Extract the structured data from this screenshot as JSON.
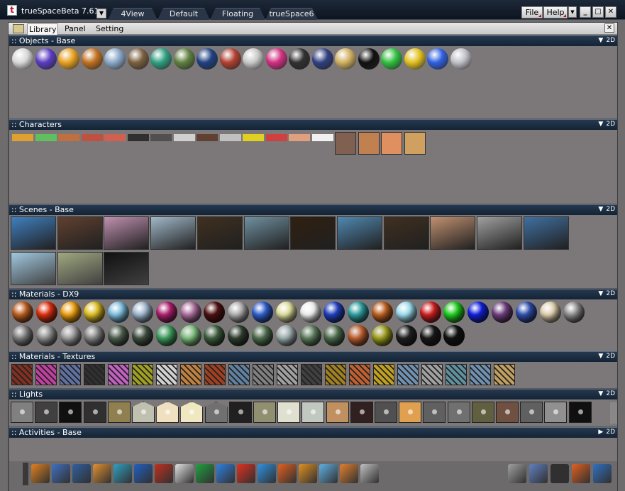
{
  "window": {
    "title": "trueSpaceBeta 7.61",
    "logo_text": "t"
  },
  "views": [
    "4View",
    "Default",
    "Floating",
    "trueSpace6"
  ],
  "menu": {
    "file": "File",
    "help": "Help"
  },
  "window_controls": {
    "minimize": "_",
    "maximize": "□",
    "close": "✕",
    "dropdown": "▼"
  },
  "panel": {
    "tabs": [
      "Library",
      "Panel",
      "Setting"
    ],
    "close": "✕"
  },
  "sections": {
    "objects": {
      "title": ":: Objects - Base",
      "ctrl": "2D"
    },
    "characters": {
      "title": ":: Characters",
      "ctrl": "2D"
    },
    "scenes": {
      "title": ":: Scenes - Base",
      "ctrl": "2D"
    },
    "materials": {
      "title": ":: Materials - DX9",
      "ctrl": "2D"
    },
    "textures": {
      "title": ":: Materials - Textures",
      "ctrl": "2D"
    },
    "lights": {
      "title": ":: Lights",
      "ctrl": "2D"
    },
    "activities": {
      "title": ":: Activities - Base",
      "ctrl": "2D"
    }
  },
  "colors": {
    "titlebar": "#142436",
    "panel": "#7c787a",
    "accent": "#c00000"
  },
  "objects": [
    {
      "name": "grid-object",
      "color": "#d8d8d8"
    },
    {
      "name": "sphere-object",
      "color": "#5a3cc0"
    },
    {
      "name": "egg-object",
      "color": "#e8a020"
    },
    {
      "name": "camel-object",
      "color": "#c07020"
    },
    {
      "name": "shark-object",
      "color": "#8aa8c8"
    },
    {
      "name": "rhino-object",
      "color": "#7a6040"
    },
    {
      "name": "fish-object",
      "color": "#30a080"
    },
    {
      "name": "tree-object",
      "color": "#608040"
    },
    {
      "name": "snake-object",
      "color": "#204080"
    },
    {
      "name": "dancer-object",
      "color": "#b04030"
    },
    {
      "name": "jet-object",
      "color": "#c8c8c8"
    },
    {
      "name": "car-object",
      "color": "#d03080"
    },
    {
      "name": "torch-object",
      "color": "#303030"
    },
    {
      "name": "truck-object",
      "color": "#304080"
    },
    {
      "name": "pharaoh-object",
      "color": "#d0b060"
    },
    {
      "name": "bomb-object",
      "color": "#101010"
    },
    {
      "name": "green-ball-object",
      "color": "#30c040"
    },
    {
      "name": "ring-object",
      "color": "#e0c020"
    },
    {
      "name": "blue-ball-object",
      "color": "#3060e0"
    },
    {
      "name": "glass-ring-object",
      "color": "#c0c0c8"
    }
  ],
  "characters": [
    "#e0a030",
    "#60c060",
    "#c07040",
    "#c05040",
    "#d06050",
    "#303030",
    "#505050",
    "#d0d0d0",
    "#604030",
    "#c0c0c0",
    "#e0d020",
    "#d04040",
    "#e0a080",
    "#f0f0f0",
    "#806050",
    "#c08050",
    "#e09060",
    "#d0a060"
  ],
  "scenes_row1": [
    "#4080c0",
    "#604030",
    "#c090b0",
    "#a0b8c8",
    "#403020",
    "#7090a0",
    "#302010",
    "#5088b0",
    "#403020",
    "#c09070",
    "#a0a0a0",
    "#4070a0"
  ],
  "scenes_row2": [
    "#a0c8e0",
    "#a0a880",
    "#101010"
  ],
  "materials_row1": [
    "#c06020",
    "#e03010",
    "#f0a010",
    "#e0c020",
    "#80c0e0",
    "#a0b8d0",
    "#b02070",
    "#b070a0",
    "#501010",
    "#b0b0b0",
    "#3060d0",
    "#e0e0a0",
    "#f0f0f0",
    "#2040c0",
    "#30a0a0",
    "#c06020",
    "#a0e0f0",
    "#d02020",
    "#20d020",
    "#1020e0",
    "#704080",
    "#3050b0",
    "#e0d0b0",
    "#909090"
  ],
  "materials_row2": [
    "#808080",
    "#909090",
    "#a0a0a0",
    "#888888",
    "#506050",
    "#405040",
    "#40a060",
    "#80c080",
    "#406040",
    "#304030",
    "#507050",
    "#a0b0b0",
    "#608060",
    "#507050",
    "#c06030",
    "#a0a020",
    "#202020",
    "#181818",
    "#101010"
  ],
  "textures": [
    "#803020",
    "#c040a0",
    "#6070a0",
    "#303030",
    "#c060c0",
    "#a0a020",
    "#d0d0d0",
    "#c08040",
    "#a04020",
    "#6080a0",
    "#808080",
    "#a0a0a0",
    "#404040",
    "#a08020",
    "#c06030",
    "#c0a020",
    "#7090b0",
    "#a0a0a0",
    "#6090a0",
    "#7090b0",
    "#c0a060"
  ],
  "lights": [
    "#808080",
    "#404040",
    "#101010",
    "#303030",
    "#908050",
    "#c0c0b0",
    "#f0e0c0",
    "#f0e8c0",
    "#707070",
    "#202020",
    "#909070",
    "#e0e0d0",
    "#c0c8c0",
    "#c09060",
    "#302020",
    "#505050",
    "#e0a050",
    "#606060",
    "#707070",
    "#606040",
    "#705040",
    "#606060",
    "#909090",
    "#101010"
  ],
  "tools_left": [
    "#e08020",
    "#4070c0",
    "#3060a0",
    "#e09030",
    "#30a0c0",
    "#2060c0",
    "#c03020",
    "#e0e0e0",
    "#20a040",
    "#3080e0",
    "#e03020",
    "#3090e0",
    "#e06020",
    "#e09020",
    "#60b0e0",
    "#e08030",
    "#c0c0c0"
  ],
  "tools_right": [
    "#a0a0a0",
    "#6080c0",
    "#303030",
    "#e06020",
    "#3070c0"
  ]
}
